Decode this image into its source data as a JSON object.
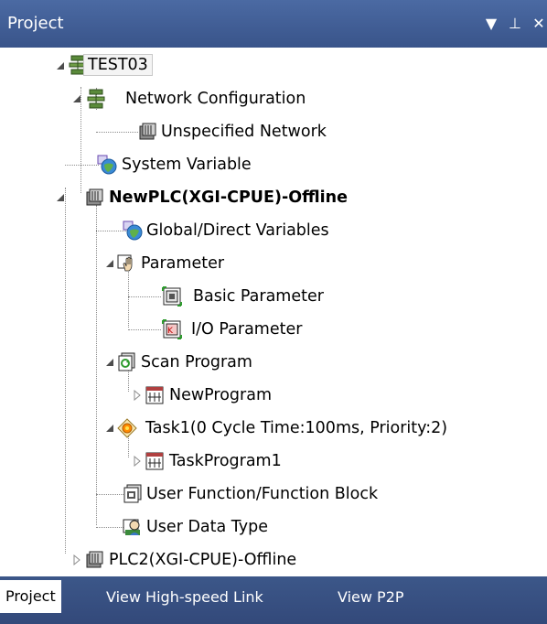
{
  "panel": {
    "title": "Project",
    "buttons": {
      "dropdown": "▼",
      "pin": "⊥",
      "close": "✕"
    }
  },
  "tree": [
    {
      "id": "test03",
      "label": "TEST03",
      "icon": "network-icon"
    },
    {
      "id": "network-config",
      "label": "Network Configuration",
      "icon": "network-icon"
    },
    {
      "id": "unspecified-network",
      "label": "Unspecified Network",
      "icon": "plc-icon"
    },
    {
      "id": "system-variable",
      "label": "System Variable",
      "icon": "variable-globe-icon"
    },
    {
      "id": "newplc",
      "label": "NewPLC(XGI-CPUE)-Offline",
      "icon": "plc-icon",
      "bold": true
    },
    {
      "id": "global-direct-vars",
      "label": "Global/Direct Variables",
      "icon": "variable-globe-icon"
    },
    {
      "id": "parameter",
      "label": "Parameter",
      "icon": "parameter-hand-icon"
    },
    {
      "id": "basic-parameter",
      "label": "Basic Parameter",
      "icon": "basic-parameter-icon"
    },
    {
      "id": "io-parameter",
      "label": "I/O Parameter",
      "icon": "io-parameter-icon"
    },
    {
      "id": "scan-program",
      "label": "Scan Program",
      "icon": "scan-program-icon"
    },
    {
      "id": "newprogram",
      "label": "NewProgram",
      "icon": "program-icon"
    },
    {
      "id": "task1",
      "label": "Task1(0 Cycle Time:100ms, Priority:2)",
      "icon": "task-icon"
    },
    {
      "id": "taskprogram1",
      "label": "TaskProgram1",
      "icon": "program-icon"
    },
    {
      "id": "user-function",
      "label": "User Function/Function Block",
      "icon": "function-block-icon"
    },
    {
      "id": "user-data-type",
      "label": "User Data Type",
      "icon": "data-type-icon"
    },
    {
      "id": "plc2",
      "label": "PLC2(XGI-CPUE)-Offline",
      "icon": "plc-icon"
    }
  ],
  "tabs": [
    {
      "label": "Project",
      "active": true
    },
    {
      "label": "View High-speed Link",
      "active": false
    },
    {
      "label": "View P2P",
      "active": false
    }
  ],
  "colors": {
    "header": "#3e5a8f",
    "tree_lines": "#8c8c8c",
    "background": "#ffffff"
  }
}
